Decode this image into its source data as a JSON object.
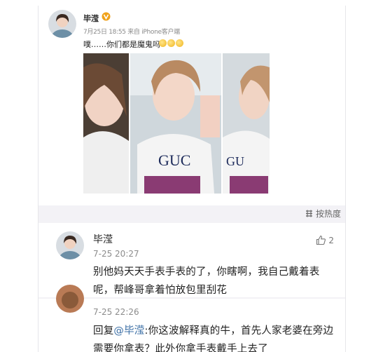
{
  "post": {
    "author": "毕滢",
    "meta": "7月25日 18:55 来自 iPhone客户端",
    "text": "噗……你们都是魔鬼吗",
    "emoji_count": 3
  },
  "sort": {
    "label": "按热度"
  },
  "comments": [
    {
      "author": "毕滢",
      "time": "7-25 20:27",
      "likes": "2",
      "text": "别他妈天天手表手表的了，你瞎啊，我自己戴着表呢，帮峰哥拿着怕放包里刮花"
    },
    {
      "time": "7-25 22:26",
      "reply_prefix": "回复",
      "mention": "@毕滢",
      "text": ":你这波解释真的牛，首先人家老婆在旁边需要你拿表？此外你拿手表戴手上去了"
    }
  ],
  "colors": {
    "link": "#3a6ea5",
    "background": "#f3f2f6",
    "verified": "#f0a21b"
  }
}
